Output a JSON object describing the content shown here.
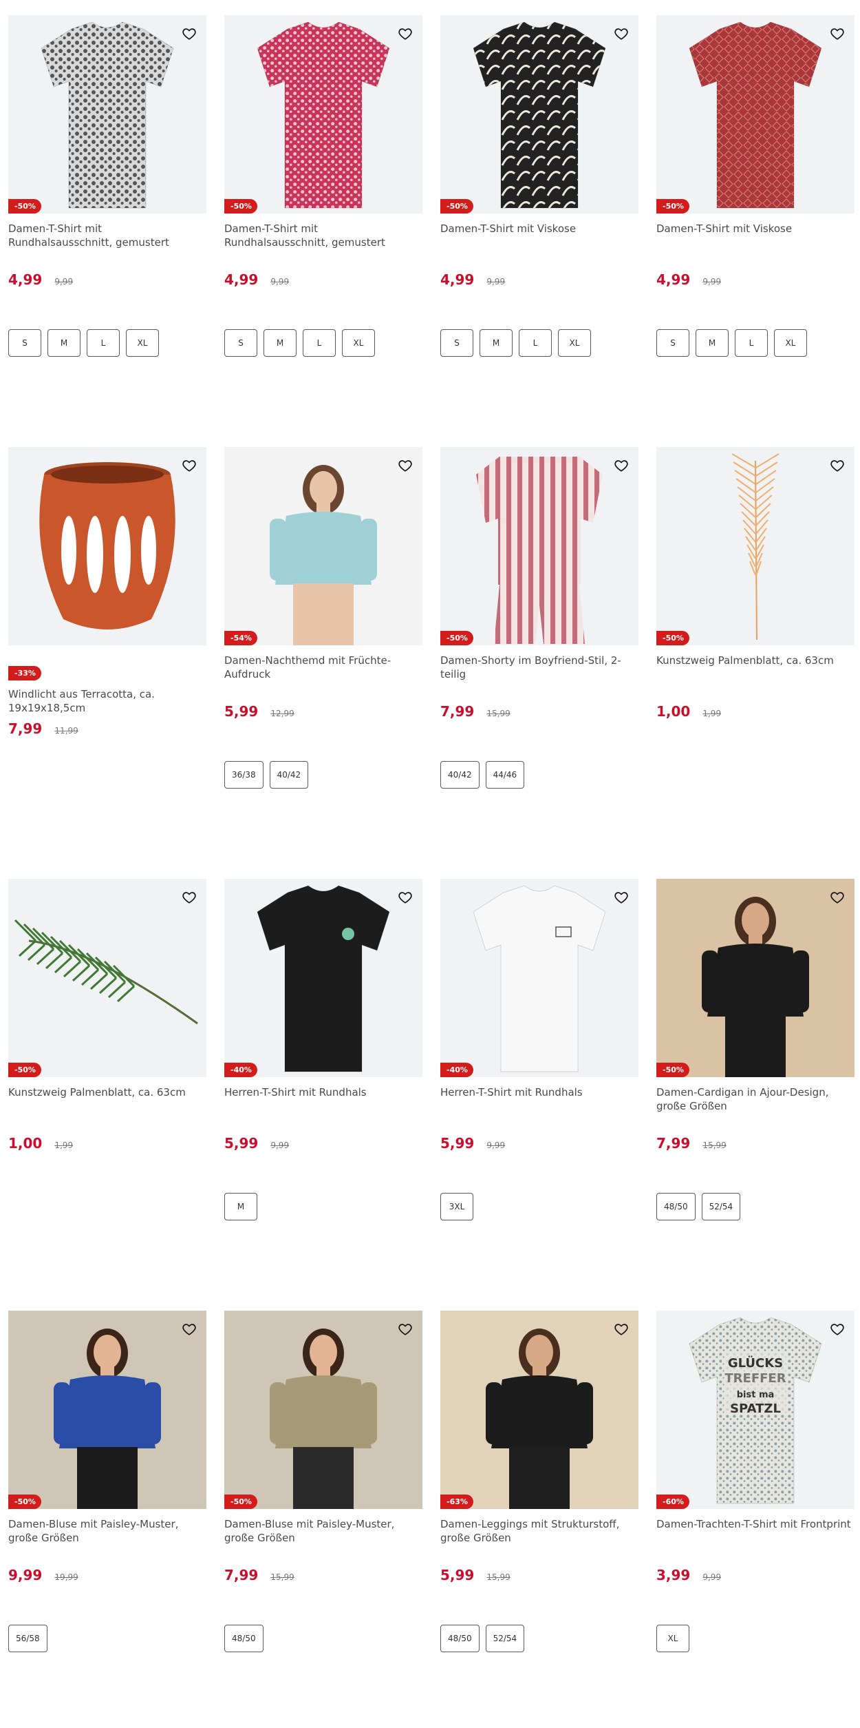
{
  "products": [
    {
      "title": "Damen-T-Shirt mit Rundhalsausschnitt, gemustert",
      "badge": "-50%",
      "price": "4,99",
      "old_price": "9,99",
      "sizes": [
        "S",
        "M",
        "L",
        "XL"
      ],
      "image": "tshirt-grey-pattern"
    },
    {
      "title": "Damen-T-Shirt mit Rundhalsausschnitt, gemustert",
      "badge": "-50%",
      "price": "4,99",
      "old_price": "9,99",
      "sizes": [
        "S",
        "M",
        "L",
        "XL"
      ],
      "image": "tshirt-pink-pattern"
    },
    {
      "title": "Damen-T-Shirt mit Viskose",
      "badge": "-50%",
      "price": "4,99",
      "old_price": "9,99",
      "sizes": [
        "S",
        "M",
        "L",
        "XL"
      ],
      "image": "tshirt-black-leaf"
    },
    {
      "title": "Damen-T-Shirt mit Viskose",
      "badge": "-50%",
      "price": "4,99",
      "old_price": "9,99",
      "sizes": [
        "S",
        "M",
        "L",
        "XL"
      ],
      "image": "tshirt-red-geo"
    },
    {
      "title": "Windlicht aus Terracotta, ca. 19x19x18,5cm",
      "badge": "-33%",
      "price": "7,99",
      "old_price": "11,99",
      "sizes": [],
      "image": "terracotta-lantern",
      "badge_below": true
    },
    {
      "title": "Damen-Nachthemd mit Früchte-Aufdruck",
      "badge": "-54%",
      "price": "5,99",
      "old_price": "12,99",
      "sizes": [
        "36/38",
        "40/42"
      ],
      "image": "nightgown-model"
    },
    {
      "title": "Damen-Shorty im Boyfriend-Stil, 2-teilig",
      "badge": "-50%",
      "price": "7,99",
      "old_price": "15,99",
      "sizes": [
        "40/42",
        "44/46"
      ],
      "image": "pyjama-striped"
    },
    {
      "title": "Kunstzweig Palmenblatt, ca. 63cm",
      "badge": "-50%",
      "price": "1,00",
      "old_price": "1,99",
      "sizes": [],
      "image": "palm-leaf-orange"
    },
    {
      "title": "Kunstzweig Palmenblatt, ca. 63cm",
      "badge": "-50%",
      "price": "1,00",
      "old_price": "1,99",
      "sizes": [],
      "image": "palm-leaf-green"
    },
    {
      "title": "Herren-T-Shirt mit Rundhals",
      "badge": "-40%",
      "price": "5,99",
      "old_price": "9,99",
      "sizes": [
        "M"
      ],
      "image": "tshirt-men-black"
    },
    {
      "title": "Herren-T-Shirt mit Rundhals",
      "badge": "-40%",
      "price": "5,99",
      "old_price": "9,99",
      "sizes": [
        "3XL"
      ],
      "image": "tshirt-men-white"
    },
    {
      "title": "Damen-Cardigan in Ajour-Design, große Größen",
      "badge": "-50%",
      "price": "7,99",
      "old_price": "15,99",
      "sizes": [
        "48/50",
        "52/54"
      ],
      "image": "cardigan-model"
    },
    {
      "title": "Damen-Bluse mit Paisley-Muster, große Größen",
      "badge": "-50%",
      "price": "9,99",
      "old_price": "19,99",
      "sizes": [
        "56/58"
      ],
      "image": "blouse-blue-model"
    },
    {
      "title": "Damen-Bluse mit Paisley-Muster, große Größen",
      "badge": "-50%",
      "price": "7,99",
      "old_price": "15,99",
      "sizes": [
        "48/50"
      ],
      "image": "blouse-beige-model"
    },
    {
      "title": "Damen-Leggings mit Strukturstoff, große Größen",
      "badge": "-63%",
      "price": "5,99",
      "old_price": "15,99",
      "sizes": [
        "48/50",
        "52/54"
      ],
      "image": "leggings-model"
    },
    {
      "title": "Damen-Trachten-T-Shirt mit Frontprint",
      "badge": "-60%",
      "price": "3,99",
      "old_price": "9,99",
      "sizes": [
        "XL"
      ],
      "image": "tshirt-trachten-print",
      "print_text": [
        "GLÜCKS",
        "TREFFER",
        "bist ma",
        "SPATZL"
      ]
    }
  ],
  "colors": {
    "accent": "#c8102e",
    "badge": "#d41c1c",
    "image_bg": "#f1f2f3"
  },
  "icons": {
    "wishlist": "heart-outline-icon"
  }
}
